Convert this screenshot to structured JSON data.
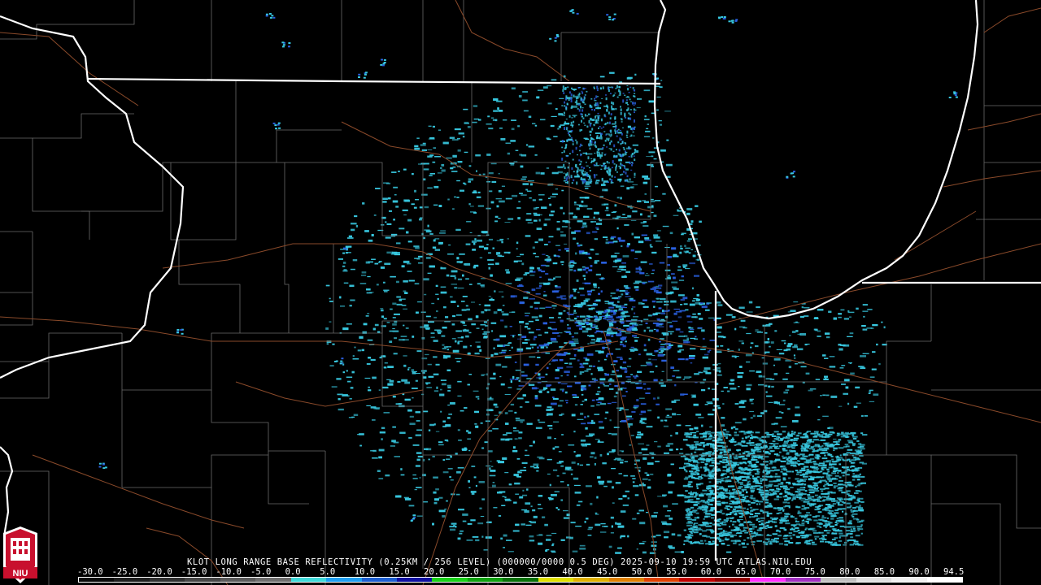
{
  "caption": "KLOT LONG RANGE BASE REFLECTIVITY (0.25KM / 256 LEVEL) (000000/0000 0.5 DEG) 2025-09-10 19:59 UTC  ATLAS.NIU.EDU",
  "logo_text": "NIU",
  "scale": {
    "labels": [
      "-30.0",
      "-25.0",
      "-20.0",
      "-15.0",
      "-10.0",
      "-5.0",
      "0.0",
      "5.0",
      "10.0",
      "15.0",
      "20.0",
      "25.0",
      "30.0",
      "35.0",
      "40.0",
      "45.0",
      "50.0",
      "55.0",
      "60.0",
      "65.0",
      "70.0",
      "75.0",
      "80.0",
      "85.0",
      "90.0",
      "94.5"
    ],
    "colors": [
      "#0a0a0a",
      "#1e1e1e",
      "#303030",
      "#464646",
      "#5a5a5a",
      "#6e6e6e",
      "#3fd9d9",
      "#1e9ef0",
      "#1c5ed0",
      "#1010a0",
      "#18d018",
      "#10a010",
      "#087008",
      "#e0e000",
      "#e0b000",
      "#e08000",
      "#e04000",
      "#c00000",
      "#900000",
      "#ff30ff",
      "#a030c0",
      "#c0c0c0",
      "#e0e0e0",
      "#f0f0f0",
      "#ffffff"
    ],
    "accent_radar": "#38c8e0",
    "accent_radar_dark": "#2a60e0"
  }
}
